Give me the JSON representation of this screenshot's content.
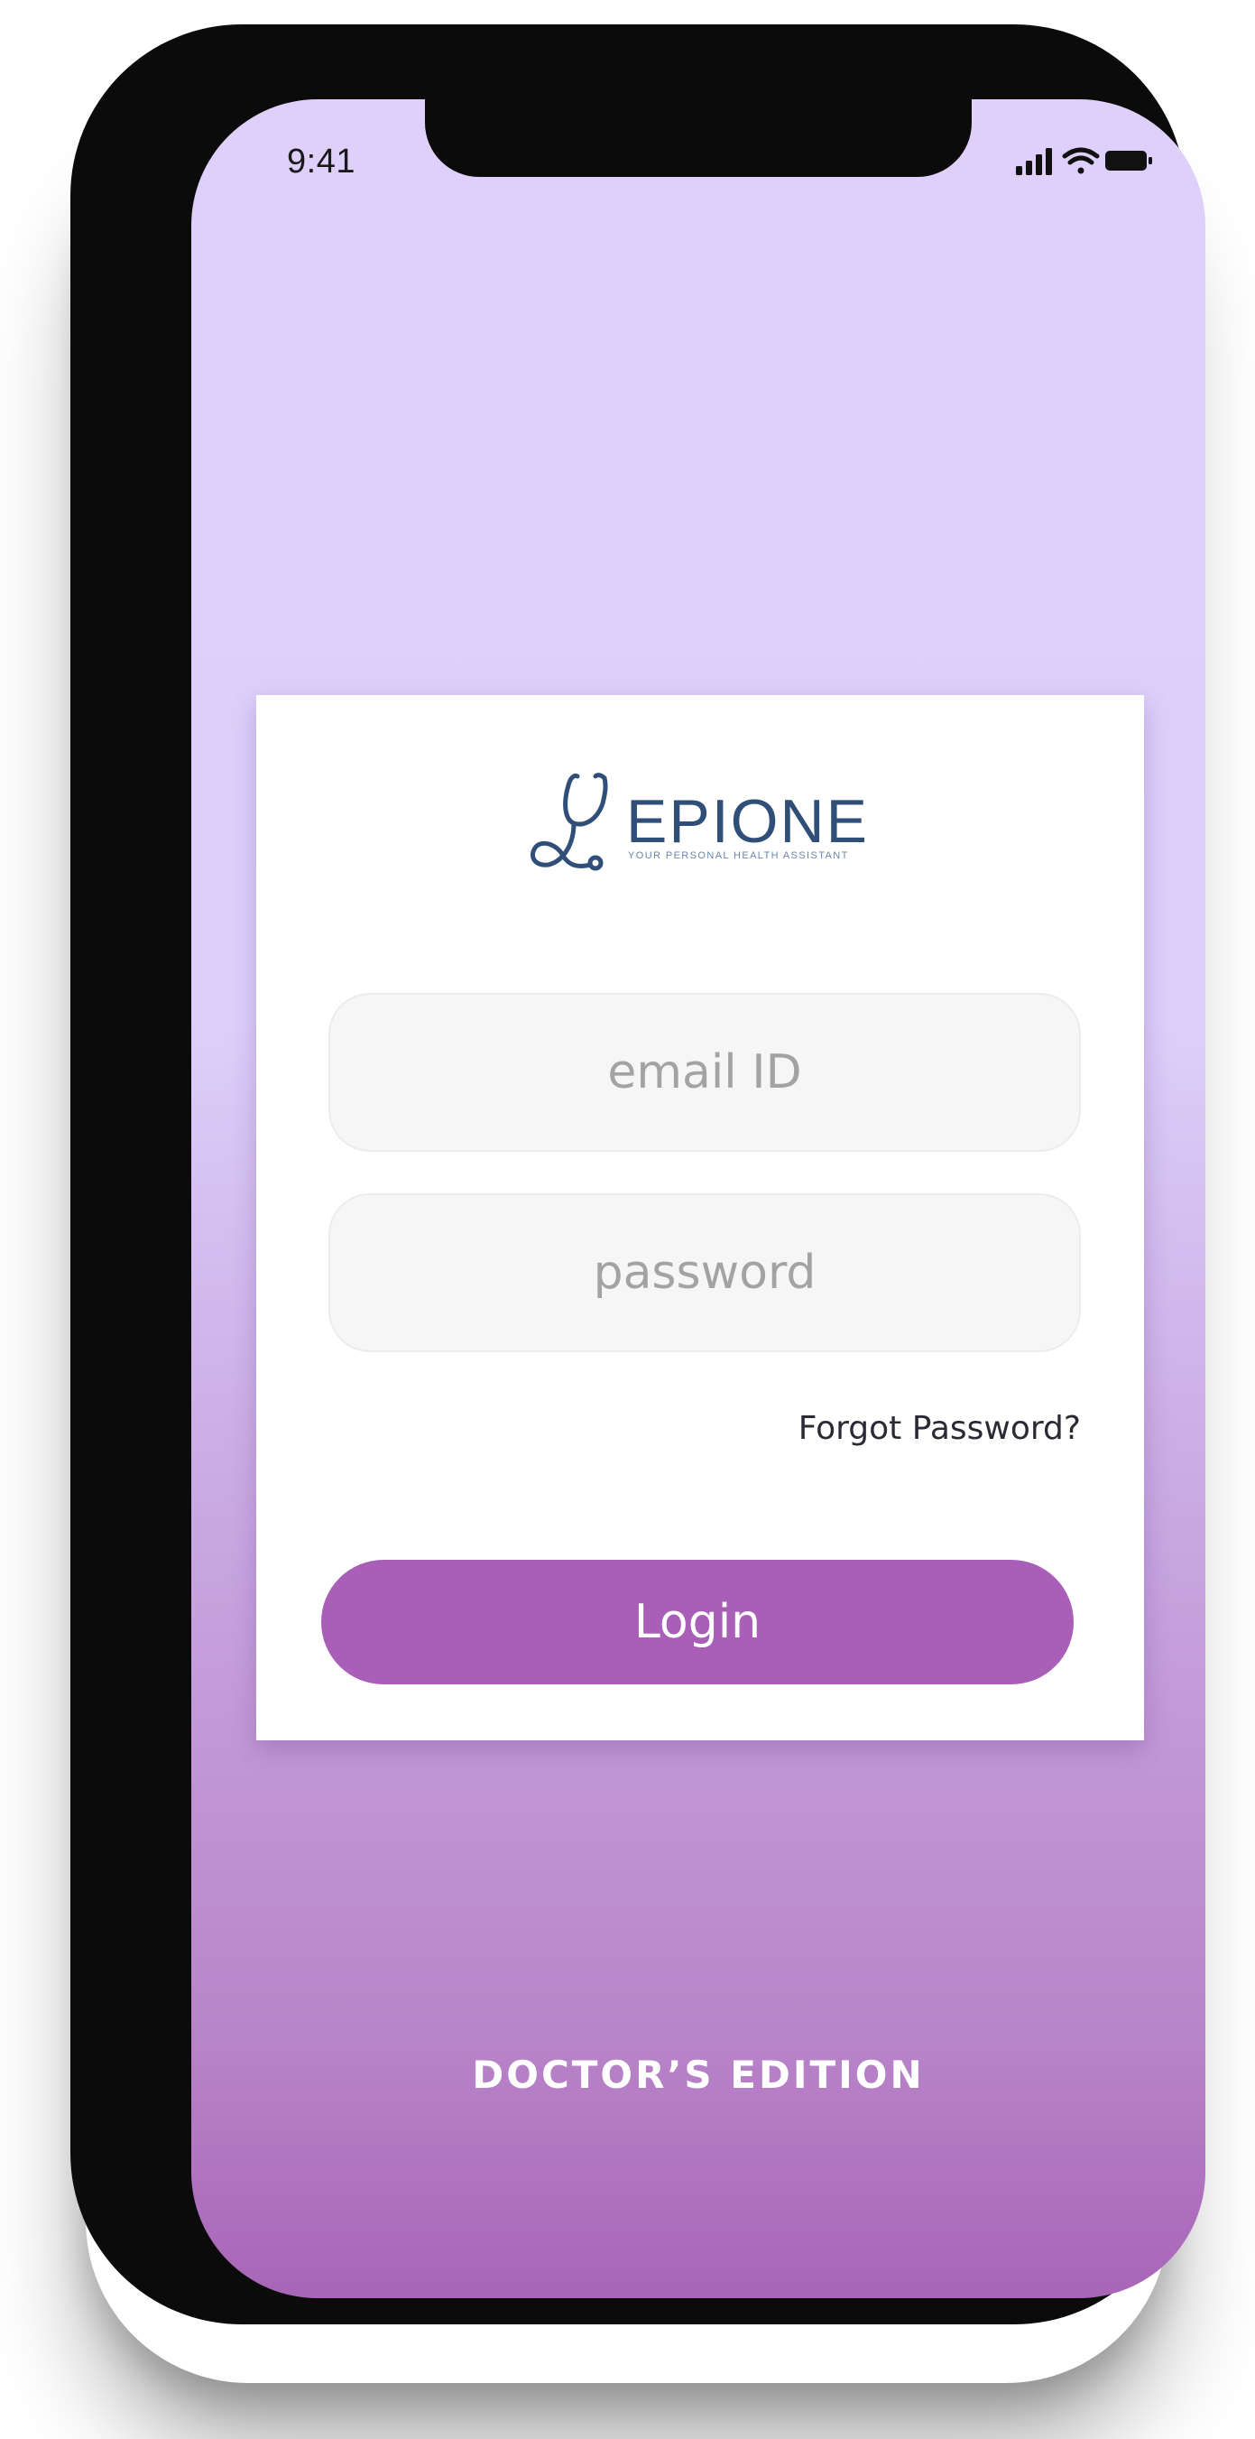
{
  "status_bar": {
    "time": "9:41",
    "icons": [
      "signal-icon",
      "wifi-icon",
      "battery-icon"
    ]
  },
  "logo": {
    "brand": "EPIONE",
    "tagline": "YOUR PERSONAL HEALTH ASSISTANT",
    "icon": "stethoscope-icon",
    "color": "#2f4e78"
  },
  "login_form": {
    "email": {
      "placeholder": "email ID",
      "value": ""
    },
    "password": {
      "placeholder": "password",
      "value": ""
    },
    "forgot_password_label": "Forgot Password?",
    "login_label": "Login"
  },
  "footer": {
    "edition_label": "DOCTOR’S EDITION"
  },
  "colors": {
    "accent": "#a95fb8",
    "background_top": "#ded0fb",
    "background_bottom": "#a865b7",
    "card": "#ffffff"
  }
}
